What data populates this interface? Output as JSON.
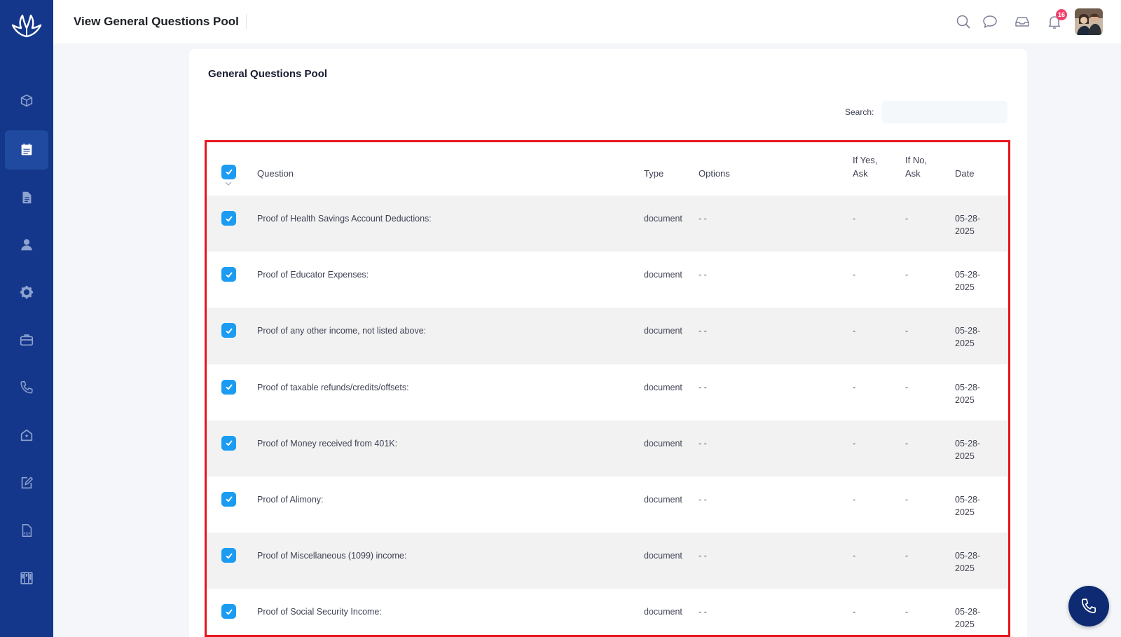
{
  "header": {
    "title": "View General Questions Pool",
    "notification_count": "16"
  },
  "sidebar": {
    "items": [
      {
        "icon": "box-arrows-icon"
      },
      {
        "icon": "calendar-list-icon",
        "active": true
      },
      {
        "icon": "document-icon"
      },
      {
        "icon": "user-icon"
      },
      {
        "icon": "gear-icon"
      },
      {
        "icon": "briefcase-icon"
      },
      {
        "icon": "phone-icon"
      },
      {
        "icon": "building-icon"
      },
      {
        "icon": "edit-icon"
      },
      {
        "icon": "pdf-icon"
      },
      {
        "icon": "kanban-icon"
      }
    ]
  },
  "card": {
    "title": "General Questions Pool",
    "search_label": "Search:",
    "search_value": ""
  },
  "table": {
    "headers": {
      "question": "Question",
      "type": "Type",
      "options": "Options",
      "if_yes_line1": "If Yes,",
      "if_yes_line2": "Ask",
      "if_no_line1": "If No,",
      "if_no_line2": "Ask",
      "date": "Date"
    },
    "rows": [
      {
        "question": "Proof of Health Savings Account Deductions:",
        "type": "document",
        "options": "- -",
        "if_yes": "-",
        "if_no": "-",
        "date_line1": "05-28-",
        "date_line2": "2025"
      },
      {
        "question": "Proof of Educator Expenses:",
        "type": "document",
        "options": "- -",
        "if_yes": "-",
        "if_no": "-",
        "date_line1": "05-28-",
        "date_line2": "2025"
      },
      {
        "question": "Proof of any other income, not listed above:",
        "type": "document",
        "options": "- -",
        "if_yes": "-",
        "if_no": "-",
        "date_line1": "05-28-",
        "date_line2": "2025"
      },
      {
        "question": "Proof of taxable refunds/credits/offsets:",
        "type": "document",
        "options": "- -",
        "if_yes": "-",
        "if_no": "-",
        "date_line1": "05-28-",
        "date_line2": "2025"
      },
      {
        "question": "Proof of Money received from 401K:",
        "type": "document",
        "options": "- -",
        "if_yes": "-",
        "if_no": "-",
        "date_line1": "05-28-",
        "date_line2": "2025"
      },
      {
        "question": "Proof of Alimony:",
        "type": "document",
        "options": "- -",
        "if_yes": "-",
        "if_no": "-",
        "date_line1": "05-28-",
        "date_line2": "2025"
      },
      {
        "question": "Proof of Miscellaneous (1099) income:",
        "type": "document",
        "options": "- -",
        "if_yes": "-",
        "if_no": "-",
        "date_line1": "05-28-",
        "date_line2": "2025"
      },
      {
        "question": "Proof of Social Security Income:",
        "type": "document",
        "options": "- -",
        "if_yes": "-",
        "if_no": "-",
        "date_line1": "05-28-",
        "date_line2": "2025"
      }
    ]
  },
  "colors": {
    "sidebar": "#14378b",
    "checkbox": "#1b9cf2",
    "highlight_border": "#e8141c",
    "badge": "#f1416c",
    "fab": "#0d2a73"
  }
}
